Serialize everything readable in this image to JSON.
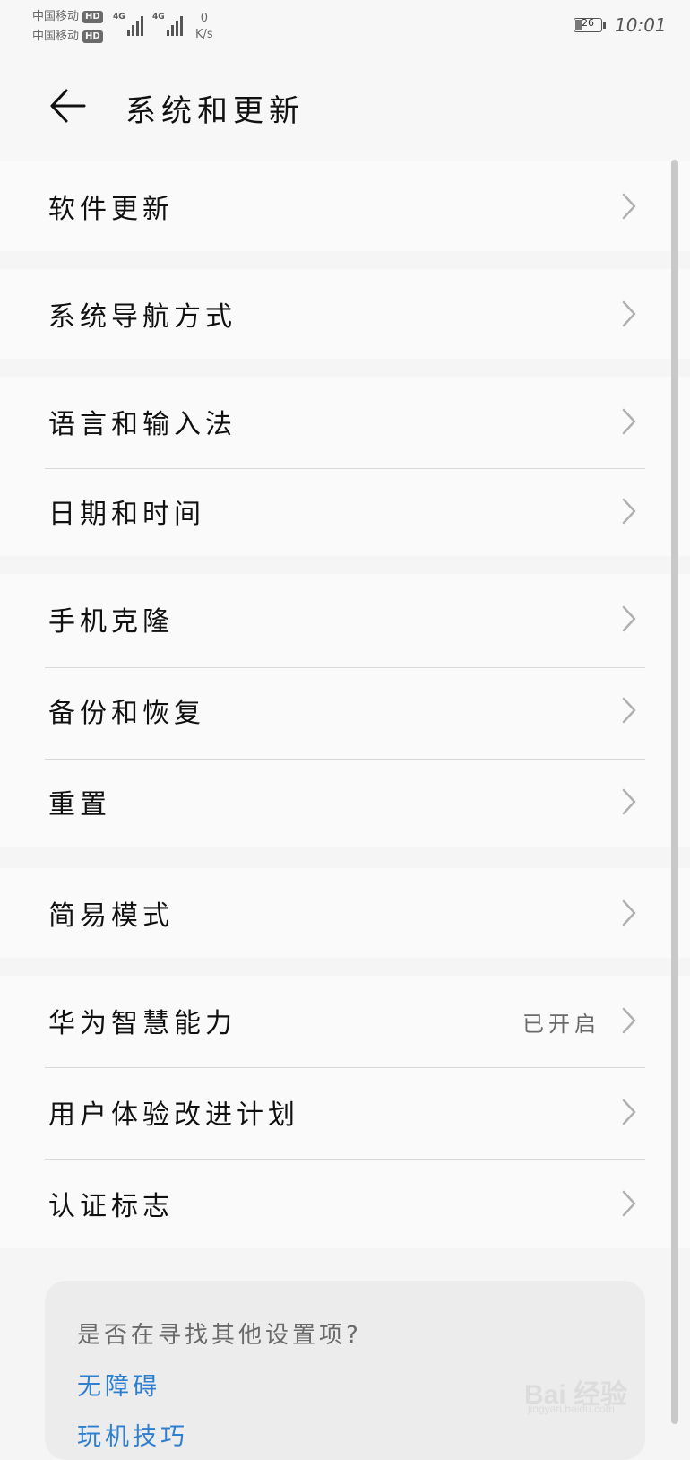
{
  "status_bar": {
    "carrier_1": "中国移动",
    "carrier_2": "中国移动",
    "hd_label": "HD",
    "network_1": "4G",
    "network_2": "4G",
    "speed_value": "0",
    "speed_unit": "K/s",
    "battery_level": "26",
    "time": "10:01"
  },
  "header": {
    "title": "系统和更新",
    "back_icon": "arrow-left-icon"
  },
  "groups": [
    {
      "items": [
        {
          "label": "软件更新",
          "value": ""
        }
      ]
    },
    {
      "items": [
        {
          "label": "系统导航方式",
          "value": ""
        }
      ]
    },
    {
      "items": [
        {
          "label": "语言和输入法",
          "value": ""
        },
        {
          "label": "日期和时间",
          "value": ""
        }
      ]
    },
    {
      "items": [
        {
          "label": "手机克隆",
          "value": ""
        },
        {
          "label": "备份和恢复",
          "value": ""
        },
        {
          "label": "重置",
          "value": ""
        }
      ]
    },
    {
      "items": [
        {
          "label": "简易模式",
          "value": ""
        }
      ]
    },
    {
      "items": [
        {
          "label": "华为智慧能力",
          "value": "已开启"
        },
        {
          "label": "用户体验改进计划",
          "value": ""
        },
        {
          "label": "认证标志",
          "value": ""
        }
      ]
    }
  ],
  "suggestions": {
    "question": "是否在寻找其他设置项?",
    "links": [
      "无障碍",
      "玩机技巧"
    ]
  },
  "watermark": {
    "text": "Bai 经验",
    "sub": "jingyan.baidu.com"
  },
  "colors": {
    "link": "#2e7fcf",
    "text": "#111111",
    "muted": "#6a6a6a"
  }
}
